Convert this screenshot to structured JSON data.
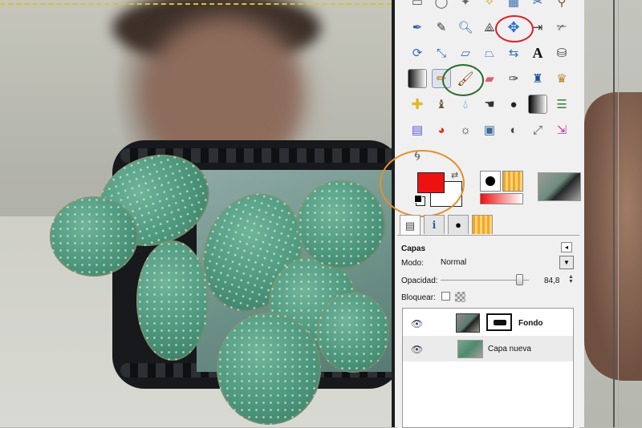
{
  "layers_panel": {
    "title": "Capas",
    "mode_label": "Modo:",
    "mode_value": "Normal",
    "opacity_label": "Opacidad:",
    "opacity_value": "84,8",
    "lock_label": "Bloquear:",
    "layers": [
      {
        "name": "Fondo",
        "bold": true
      },
      {
        "name": "Capa nueva",
        "bold": false
      }
    ]
  },
  "colors": {
    "foreground": "#ee1111",
    "background": "#ffffff",
    "annotation_red": "#d8202a",
    "annotation_green": "#2b6a2b",
    "annotation_orange": "#e4902c"
  },
  "toolbox": {
    "active_tool": "paintbrush-tool",
    "annotated_tools": [
      "move-tool",
      "paintbrush-tool",
      "color-area"
    ]
  }
}
